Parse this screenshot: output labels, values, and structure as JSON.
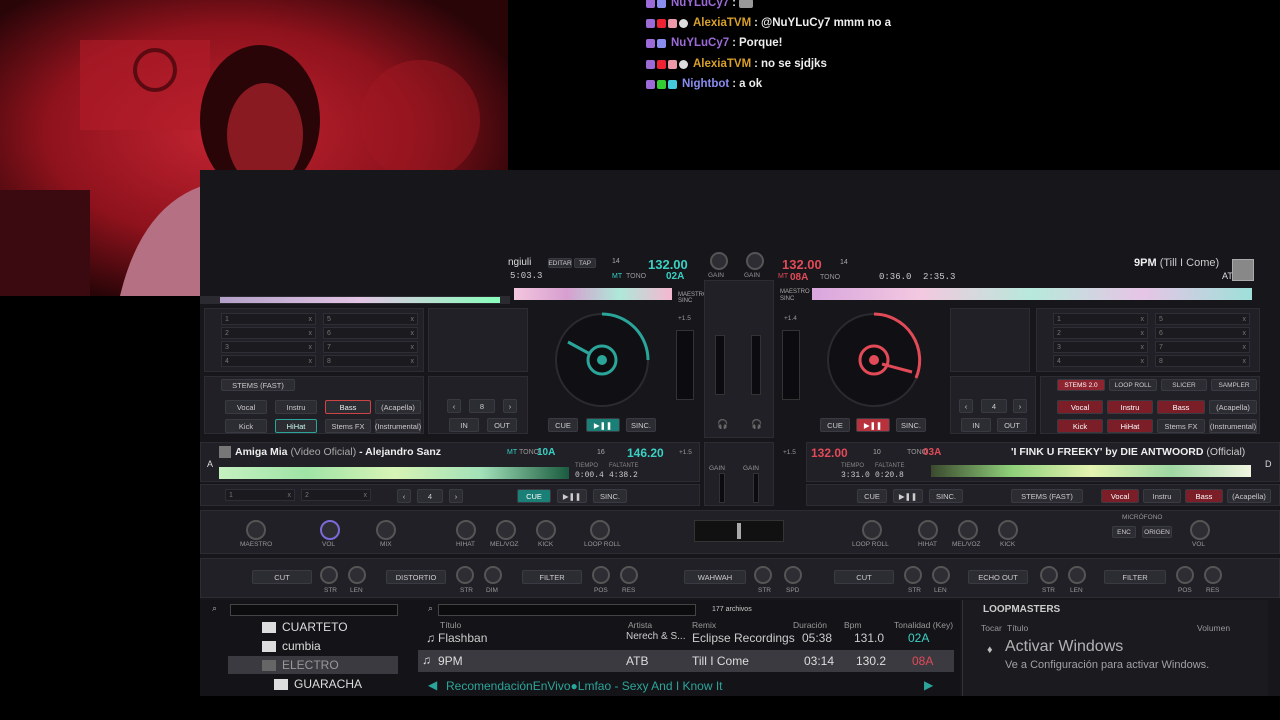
{
  "chat": {
    "lines": [
      {
        "user": "NuYLuCy7",
        "sep": ":",
        "message": "",
        "userColor": "#9c6bd8"
      },
      {
        "user": "AlexiaTVM",
        "sep": ":",
        "message": "@NuYLuCy7 mmm no a",
        "userColor": "#d8a02a"
      },
      {
        "user": "NuYLuCy7",
        "sep": ":",
        "message": "Porque!",
        "userColor": "#9c6bd8"
      },
      {
        "user": "AlexiaTVM",
        "sep": ":",
        "message": "no se sjdjks",
        "userColor": "#d8a02a"
      },
      {
        "user": "Nightbot",
        "sep": ":",
        "message": "a ok",
        "userColor": "#8a8cf0"
      }
    ]
  },
  "deckTopLeft": {
    "title_partial": "ngiuli",
    "time": "5:03.3",
    "edit": "EDITAR",
    "tap": "TAP",
    "bpm": "132.00",
    "bpmSmall": "14",
    "key": "02A",
    "mt": "MT",
    "tono": "TONO",
    "sync": "SINC",
    "master": "MAESTRO"
  },
  "deckTopRight": {
    "bpm": "132.00",
    "bpmSmall": "14",
    "key": "08A",
    "mt": "MT",
    "tono": "TONO",
    "elapsed": "0:36.0",
    "remain": "2:35.3",
    "title": "9PM",
    "subtitle": "(Till I Come)",
    "artist": "ATB",
    "master": "MAESTRO",
    "sync": "SINC"
  },
  "gain": {
    "left": "GAIN",
    "right": "GAIN"
  },
  "leftDeck": {
    "pads": [
      "1",
      "2",
      "3",
      "4",
      "5",
      "6",
      "7",
      "8"
    ],
    "stems": "STEMS (FAST)",
    "stemButtons": [
      "Vocal",
      "Instru",
      "Bass",
      "(Acapella)",
      "Kick",
      "HiHat",
      "Stems FX",
      "(Instrumental)"
    ],
    "loopSize": "8",
    "in": "IN",
    "out": "OUT",
    "cue": "CUE",
    "play": "▶❚❚",
    "sync": "SINC.",
    "pitch": "+1.5"
  },
  "rightDeck": {
    "pads": [
      "1",
      "2",
      "3",
      "4",
      "5",
      "6",
      "7",
      "8"
    ],
    "modes": [
      "STEMS 2.0",
      "LOOP ROLL",
      "SLICER",
      "SAMPLER"
    ],
    "stemButtons": [
      "Vocal",
      "Instru",
      "Bass",
      "(Acapella)",
      "Kick",
      "HiHat",
      "Stems FX",
      "(Instrumental)"
    ],
    "loopSize": "4",
    "in": "IN",
    "out": "OUT",
    "cue": "CUE",
    "play": "▶❚❚",
    "sync": "SINC.",
    "pitch": "+1.4"
  },
  "deckA": {
    "letter": "A",
    "title": "Amiga Mia",
    "subtitle": "(Video Oficial)",
    "artist": "- Alejandro Sanz",
    "mt": "MT",
    "tono": "TONO",
    "key": "10A",
    "bpm": "146.20",
    "bpmSmall": "16",
    "tempo": "TIEMPO",
    "remaining": "FALTANTE",
    "elapsed": "0:00.4",
    "remain": "4:38.2",
    "pitch": "+1.5",
    "slot1": "1",
    "slot2": "2",
    "loop": "4",
    "cue": "CUE",
    "play": "▶❚❚",
    "sync": "SINC."
  },
  "deckD": {
    "letter": "D",
    "title": "'I FINK U FREEKY' by DIE ANTWOORD",
    "subtitle": "(Official)",
    "bpm": "132.00",
    "bpmSmall": "10",
    "key": "03A",
    "tono": "TONO",
    "tempo": "TIEMPO",
    "remaining": "FALTANTE",
    "elapsed": "3:31.0",
    "remain": "0:20.8",
    "pitch": "+1.5",
    "stems": "STEMS (FAST)",
    "stemButtons": [
      "Vocal",
      "Instru",
      "Bass",
      "(Acapella)"
    ],
    "cue": "CUE",
    "play": "▶❚❚",
    "sync": "SINC."
  },
  "fxRow": {
    "labels": [
      "MAESTRO",
      "VOL",
      "MIX",
      "HIHAT",
      "MEL/VOZ",
      "KICK",
      "LOOP ROLL",
      "LOOP ROLL",
      "HIHAT",
      "MEL/VOZ",
      "KICK",
      "MICRÓFONO",
      "VOL"
    ],
    "mic": [
      "ENC",
      "ORIGEN"
    ]
  },
  "effects": {
    "left": [
      "CUT",
      "DISTORTIO",
      "FILTER"
    ],
    "center": "WAHWAH",
    "right": [
      "CUT",
      "ECHO OUT",
      "FILTER"
    ],
    "knobLabels": [
      "STR",
      "LEN",
      "STR",
      "DIM",
      "POS",
      "RES",
      "STR",
      "SPD",
      "STR",
      "LEN",
      "STR",
      "LEN",
      "POS",
      "RES"
    ]
  },
  "browser": {
    "folders": [
      "CUARTETO",
      "cumbia",
      "ELECTRO",
      "GUARACHA"
    ],
    "fileCount": "177 archivos",
    "columns": [
      "Título",
      "Artista",
      "Remix",
      "Duración",
      "Bpm",
      "Tonalidad (Key)"
    ],
    "rows": [
      {
        "title": "Flashban",
        "artist": "Nerech & S...",
        "remix": "Eclipse Recordings",
        "duration": "05:38",
        "bpm": "131.0",
        "key": "02A"
      },
      {
        "title": "9PM",
        "artist": "ATB",
        "remix": "Till I Come",
        "duration": "03:14",
        "bpm": "130.2",
        "key": "08A"
      }
    ],
    "nowPlaying": "RecomendaciónEnVivo●Lmfao - Sexy And I Know It"
  },
  "sidepanel": {
    "title": "LOOPMASTERS",
    "col1": "Tocar",
    "col2": "Título",
    "col3": "Volumen",
    "activate": "Activar Windows",
    "activateSub": "Ve a Configuración para activar Windows."
  },
  "colors": {
    "teal": "#3ad1c4",
    "red": "#e34a58",
    "accent": "#2ba59a"
  }
}
